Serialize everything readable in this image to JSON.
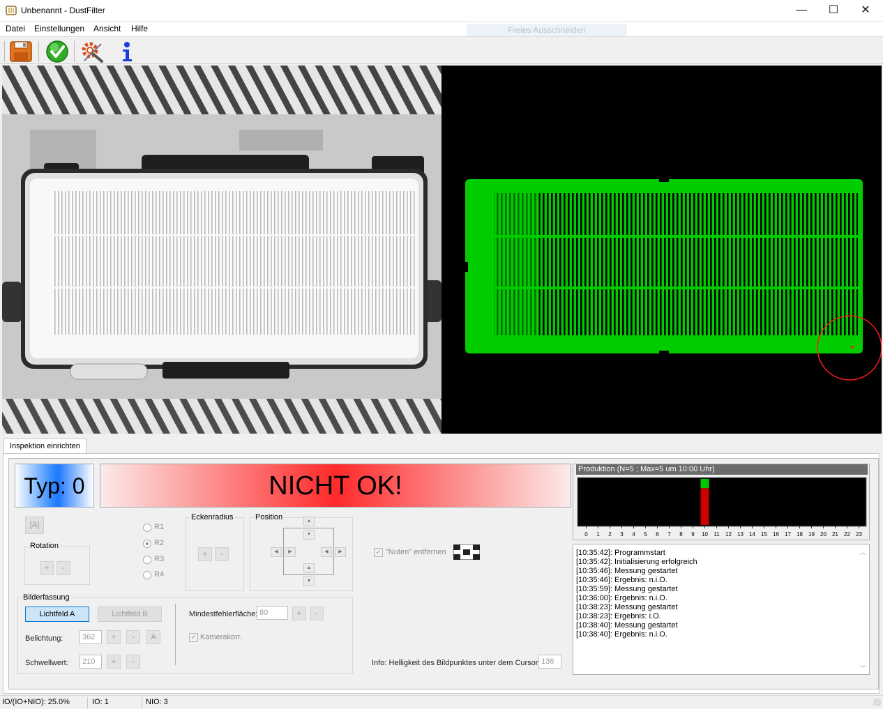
{
  "window": {
    "title": "Unbenannt - DustFilter",
    "minimize_glyph": "—",
    "maximize_glyph": "☐",
    "close_glyph": "✕"
  },
  "menu": [
    "Datei",
    "Einstellungen",
    "Ansicht",
    "Hilfe"
  ],
  "ghost_label": "Freies Ausschneiden",
  "toolbar": [
    {
      "icon": "floppy-disk-icon"
    },
    {
      "icon": "green-check-icon"
    },
    {
      "icon": "tools-settings-icon"
    },
    {
      "icon": "info-icon"
    }
  ],
  "tab": {
    "label": "Inspektion einrichten"
  },
  "typ": {
    "label": "Typ: 0",
    "color": "#1f78ff"
  },
  "result": {
    "label": "NICHT OK!",
    "color": "#ff0000"
  },
  "controls": {
    "a_button": "[A]",
    "rotation": {
      "title": "Rotation",
      "plus": "+",
      "minus": "-"
    },
    "radius_options": [
      "R1",
      "R2",
      "R3",
      "R4"
    ],
    "radius_selected": "R2",
    "eckenradius": {
      "title": "Eckenradius",
      "plus": "+",
      "minus": "-"
    },
    "position": {
      "title": "Position"
    },
    "nuten": {
      "label": "\"Nuten\" entfernen",
      "checked": true
    },
    "bilderfassung": {
      "title": "Bilderfassung",
      "lichtfeld_a": "Lichtfeld A",
      "lichtfeld_b": "Lichtfeld B",
      "belichtung_label": "Belichtung:",
      "belichtung_value": "362",
      "schwellwert_label": "Schwellwert:",
      "schwellwert_value": "210",
      "plus": "+",
      "minus": "-",
      "auto": "A",
      "mindest_label": "Mindestfehlerfläche:",
      "mindest_value": "80",
      "kamerakorr_label": "Kamerakorr.",
      "kamerakorr_checked": true
    },
    "info_label": "Info: Helligkeit des Bildpunktes unter dem Cursor:",
    "info_value": "136"
  },
  "production": {
    "title": "Produktion (N=5 ; Max=5 um 10:00 Uhr)",
    "hours": [
      "0",
      "1",
      "2",
      "3",
      "4",
      "5",
      "6",
      "7",
      "8",
      "9",
      "10",
      "11",
      "12",
      "13",
      "14",
      "15",
      "16",
      "17",
      "18",
      "19",
      "20",
      "21",
      "22",
      "23"
    ],
    "io": [
      0,
      0,
      0,
      0,
      0,
      0,
      0,
      0,
      0,
      0,
      1,
      0,
      0,
      0,
      0,
      0,
      0,
      0,
      0,
      0,
      0,
      0,
      0,
      0
    ],
    "nio": [
      0,
      0,
      0,
      0,
      0,
      0,
      0,
      0,
      0,
      0,
      4,
      0,
      0,
      0,
      0,
      0,
      0,
      0,
      0,
      0,
      0,
      0,
      0,
      0
    ],
    "io_color": "#00c800",
    "nio_color": "#cc0000"
  },
  "log": [
    "[10:35:42]: Programmstart",
    "[10:35:42]: Initialisierung erfolgreich",
    "[10:35:46]: Messung gestartet",
    "[10:35:46]: Ergebnis: n.i.O.",
    "[10:35:59]: Messung gestartet",
    "[10:36:00]: Ergebnis: n.i.O.",
    "[10:38:23]: Messung gestartet",
    "[10:38:23]: Ergebnis: i.O.",
    "[10:38:40]: Messung gestartet",
    "[10:38:40]: Ergebnis: n.i.O."
  ],
  "status": {
    "ratio": "IO/(IO+NIO): 25.0%",
    "io": "IO: 1",
    "nio": "NIO: 3"
  }
}
